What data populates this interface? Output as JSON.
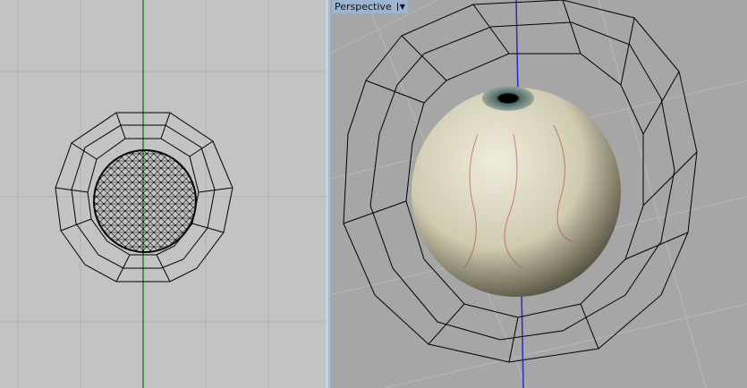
{
  "left_viewport": {
    "view": "top-orthographic",
    "axis_color": "#1a8a1a"
  },
  "right_viewport": {
    "label": "Perspective",
    "menu_icon": "dropdown-arrow-icon",
    "axis_color": "#2a2ac8"
  }
}
